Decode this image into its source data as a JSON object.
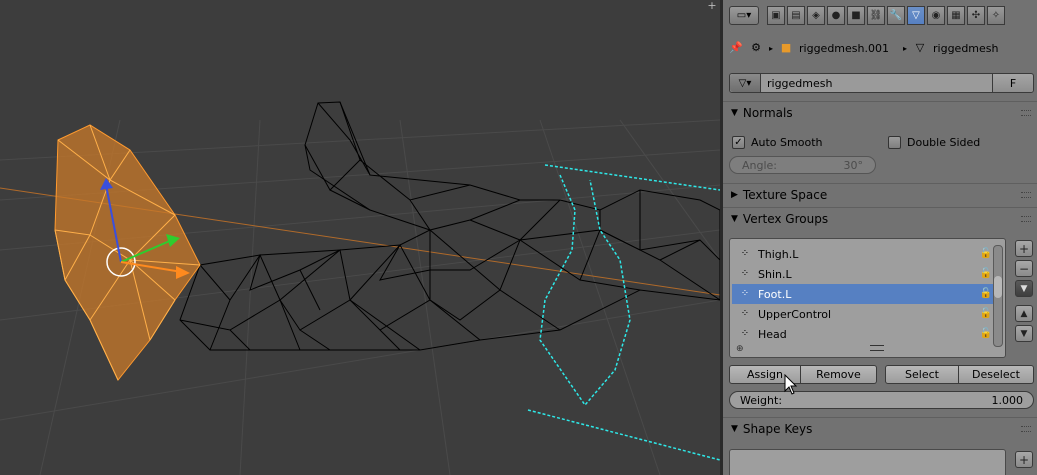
{
  "viewport": {
    "corner_plus": "+"
  },
  "properties": {
    "context_tabs": [
      {
        "icon": "render-icon",
        "glyph": "▣"
      },
      {
        "icon": "render-layers-icon",
        "glyph": "▤"
      },
      {
        "icon": "scene-icon",
        "glyph": "◈"
      },
      {
        "icon": "world-icon",
        "glyph": "●"
      },
      {
        "icon": "object-icon",
        "glyph": "■"
      },
      {
        "icon": "constraints-icon",
        "glyph": "⛓"
      },
      {
        "icon": "modifiers-icon",
        "glyph": "🔧"
      },
      {
        "icon": "mesh-data-icon",
        "glyph": "▽"
      },
      {
        "icon": "material-icon",
        "glyph": "◉"
      },
      {
        "icon": "texture-icon",
        "glyph": "▦"
      },
      {
        "icon": "particles-icon",
        "glyph": "✣"
      },
      {
        "icon": "physics-icon",
        "glyph": "✧"
      }
    ],
    "breadcrumb": {
      "object": "riggedmesh.001",
      "mesh": "riggedmesh"
    },
    "mesh_name": "riggedmesh",
    "fake_user": "F",
    "normals": {
      "title": "Normals",
      "auto_smooth": "Auto Smooth",
      "double_sided": "Double Sided",
      "angle_label": "Angle:",
      "angle_value": "30°"
    },
    "texture_space": {
      "title": "Texture Space"
    },
    "vertex_groups": {
      "title": "Vertex Groups",
      "items": [
        {
          "name": "Thigh.L"
        },
        {
          "name": "Shin.L"
        },
        {
          "name": "Foot.L"
        },
        {
          "name": "UpperControl"
        },
        {
          "name": "Head"
        }
      ],
      "selected_index": 2,
      "assign": "Assign",
      "remove": "Remove",
      "select": "Select",
      "deselect": "Deselect",
      "weight_label": "Weight:",
      "weight_value": "1.000"
    },
    "shape_keys": {
      "title": "Shape Keys"
    }
  },
  "colors": {
    "viewport_bg": "#3d3d3d",
    "panel_bg": "#727272",
    "selection": "#5680c2",
    "selected_mesh": "#ff9a2e",
    "active_wire": "#2ee8e8"
  }
}
